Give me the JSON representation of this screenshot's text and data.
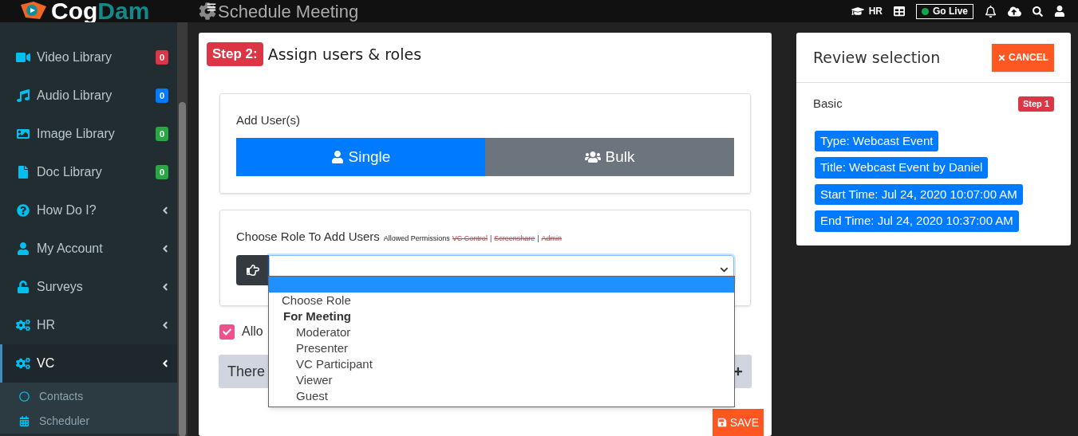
{
  "header": {
    "logo": [
      "Cog",
      "Dam"
    ],
    "title": "Schedule Meeting",
    "hr_label": "HR",
    "go_live": "Go Live"
  },
  "sidebar": {
    "items": [
      {
        "label": "Video Library",
        "kind": "badge",
        "badge": "0",
        "color": "#dc3545",
        "selected": false
      },
      {
        "label": "Audio Library",
        "kind": "badge",
        "badge": "0",
        "color": "#007bff",
        "selected": false
      },
      {
        "label": "Image Library",
        "kind": "badge",
        "badge": "0",
        "color": "#28a745",
        "selected": false
      },
      {
        "label": "Doc Library",
        "kind": "badge",
        "badge": "0",
        "color": "#28a745",
        "selected": false
      },
      {
        "label": "How Do I?",
        "kind": "menu",
        "selected": false
      },
      {
        "label": "My Account",
        "kind": "menu",
        "selected": false
      },
      {
        "label": "Surveys",
        "kind": "menu",
        "selected": false
      },
      {
        "label": "HR",
        "kind": "menu",
        "selected": false
      },
      {
        "label": "VC",
        "kind": "menu",
        "selected": true,
        "children": [
          {
            "label": "Contacts"
          },
          {
            "label": "Scheduler"
          }
        ]
      }
    ]
  },
  "main": {
    "step": "Step 2:",
    "heading": "Assign users & roles",
    "add_users": {
      "label": "Add User(s)",
      "tabs": [
        {
          "label": "Single",
          "selected": true
        },
        {
          "label": "Bulk",
          "selected": false
        }
      ]
    },
    "role": {
      "label": "Choose Role To Add Users",
      "permissions_label": "Allowed Permissions",
      "separator": "|",
      "permissions": [
        {
          "label": "VC Control",
          "allowed": false
        },
        {
          "label": "Screenshare",
          "allowed": false
        },
        {
          "label": "Admin",
          "allowed": false
        }
      ],
      "dropdown": {
        "options": [
          {
            "label": "Choose Role",
            "kind": "option"
          },
          {
            "label": "For Meeting",
            "kind": "group"
          },
          {
            "label": "Moderator",
            "kind": "sub"
          },
          {
            "label": "Presenter",
            "kind": "sub"
          },
          {
            "label": "VC Participant",
            "kind": "sub"
          },
          {
            "label": "Viewer",
            "kind": "sub"
          },
          {
            "label": "Guest",
            "kind": "sub"
          }
        ]
      }
    },
    "allow": {
      "label": "Allo",
      "checked": true
    },
    "notice": "There",
    "save": "SAVE"
  },
  "review": {
    "title": "Review selection",
    "cancel": "CANCEL",
    "section": "Basic",
    "step": "Step 1",
    "tags": [
      "Type: Webcast Event",
      "Title: Webcast Event by Daniel",
      "Start Time: Jul 24, 2020 10:07:00 AM",
      "End Time: Jul 24, 2020 10:37:00 AM"
    ]
  }
}
